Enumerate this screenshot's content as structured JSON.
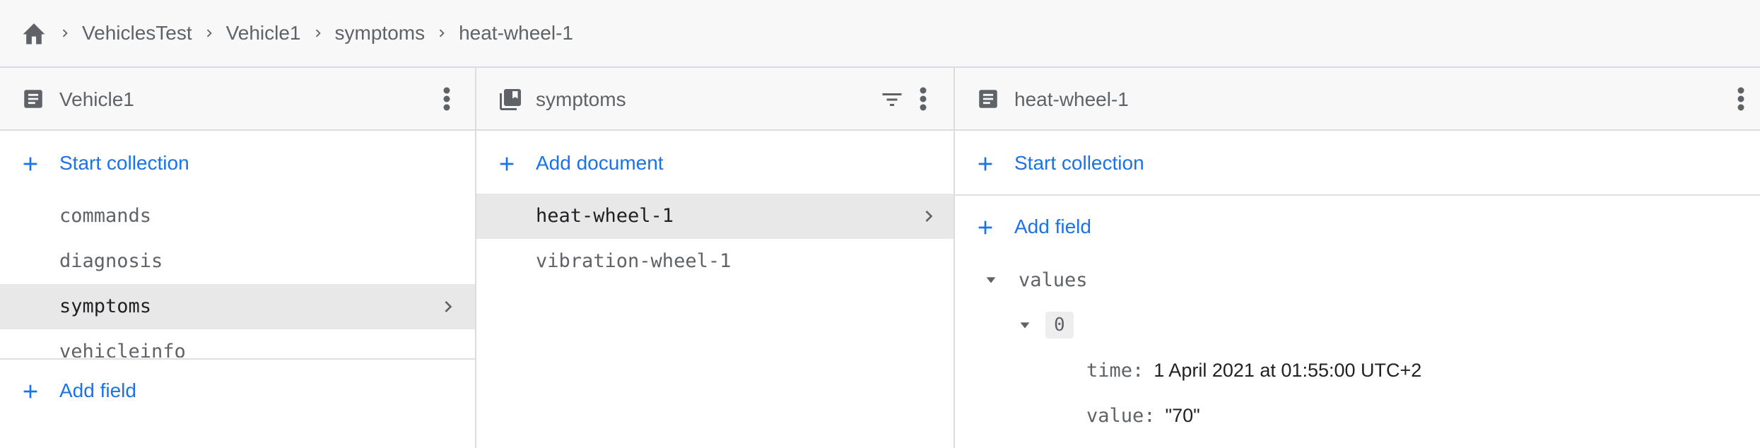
{
  "breadcrumb": {
    "home_icon": "home-icon",
    "separator_icon": "chevron-right-icon",
    "items": [
      "VehiclesTest",
      "Vehicle1",
      "symptoms",
      "heat-wheel-1"
    ]
  },
  "panel_document": {
    "icon": "document-icon",
    "title": "Vehicle1",
    "menu_icon": "more-vert-icon",
    "start_collection_label": "Start collection",
    "collections": [
      "commands",
      "diagnosis",
      "symptoms",
      "vehicleinfo"
    ],
    "selected_collection": "symptoms",
    "add_field_label": "Add field"
  },
  "panel_collection": {
    "icon": "collection-icon",
    "title": "symptoms",
    "filter_icon": "filter-icon",
    "menu_icon": "more-vert-icon",
    "add_document_label": "Add document",
    "documents": [
      "heat-wheel-1",
      "vibration-wheel-1"
    ],
    "selected_document": "heat-wheel-1"
  },
  "panel_fields": {
    "icon": "document-icon",
    "title": "heat-wheel-1",
    "menu_icon": "more-vert-icon",
    "start_collection_label": "Start collection",
    "add_field_label": "Add field",
    "field_name": "values",
    "array_index": "0",
    "entries": [
      {
        "key": "time:",
        "value": "1 April 2021 at 01:55:00 UTC+2"
      },
      {
        "key": "value:",
        "value": "\"70\""
      }
    ]
  },
  "colors": {
    "accent": "#1a73e8",
    "header_bg": "#f8f8f8",
    "selected_bg": "#e8e8e8",
    "border": "#dadce0"
  }
}
